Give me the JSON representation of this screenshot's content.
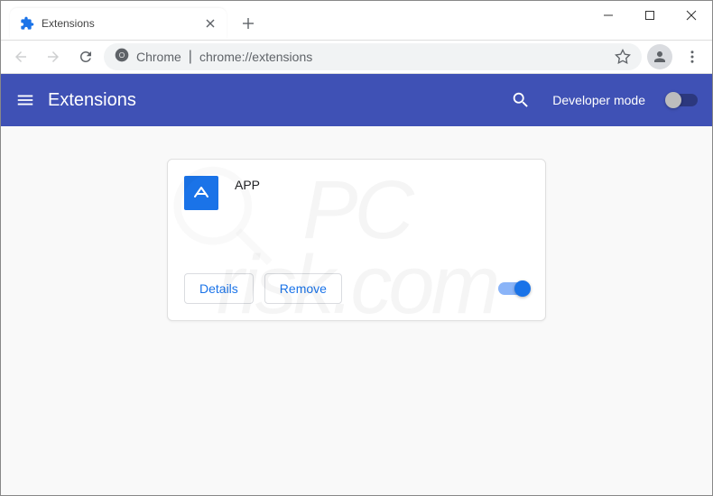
{
  "window": {
    "tab_title": "Extensions",
    "url_label": "Chrome",
    "url_path": "chrome://extensions"
  },
  "header": {
    "title": "Extensions",
    "dev_mode_label": "Developer mode"
  },
  "extension": {
    "name": "APP",
    "details_label": "Details",
    "remove_label": "Remove",
    "icon_letter": "A"
  },
  "watermark": {
    "line1": "PC",
    "line2": "risk.com"
  }
}
